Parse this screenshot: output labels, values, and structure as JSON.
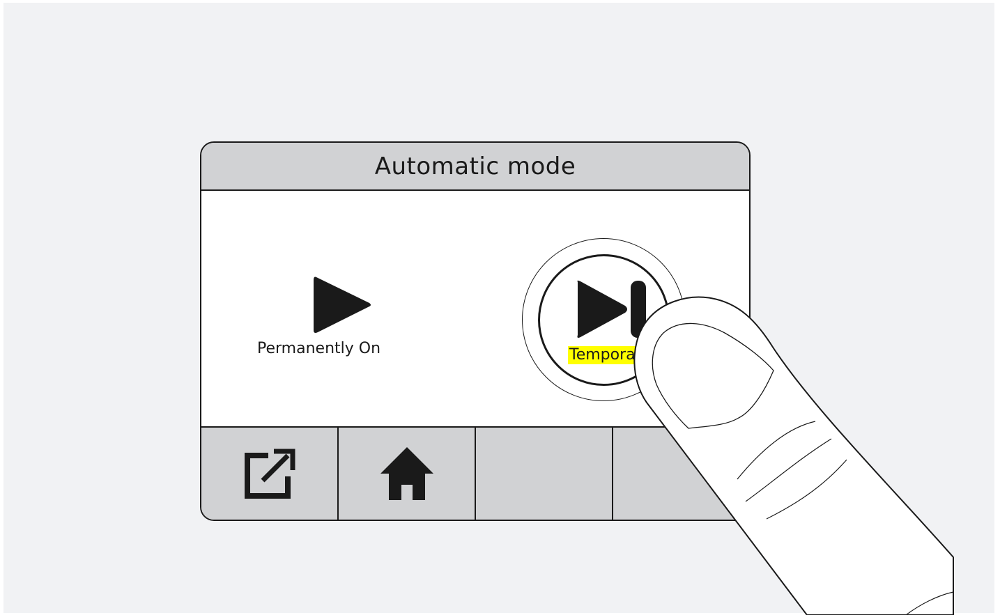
{
  "screen": {
    "title": "Automatic mode"
  },
  "modes": [
    {
      "label": "Permanently On",
      "icon": "play-icon",
      "selected": false
    },
    {
      "label": "Temporarily On",
      "icon": "skip-forward-icon",
      "selected": true,
      "visible_text": "Tempora"
    }
  ],
  "footer": {
    "buttons": [
      {
        "icon": "external-link-icon"
      },
      {
        "icon": "home-icon"
      },
      {
        "icon": ""
      },
      {
        "icon": ""
      }
    ]
  },
  "colors": {
    "background": "#f1f2f4",
    "bar": "#d1d2d4",
    "highlight": "#ffff00",
    "ink": "#1a1a1a"
  }
}
